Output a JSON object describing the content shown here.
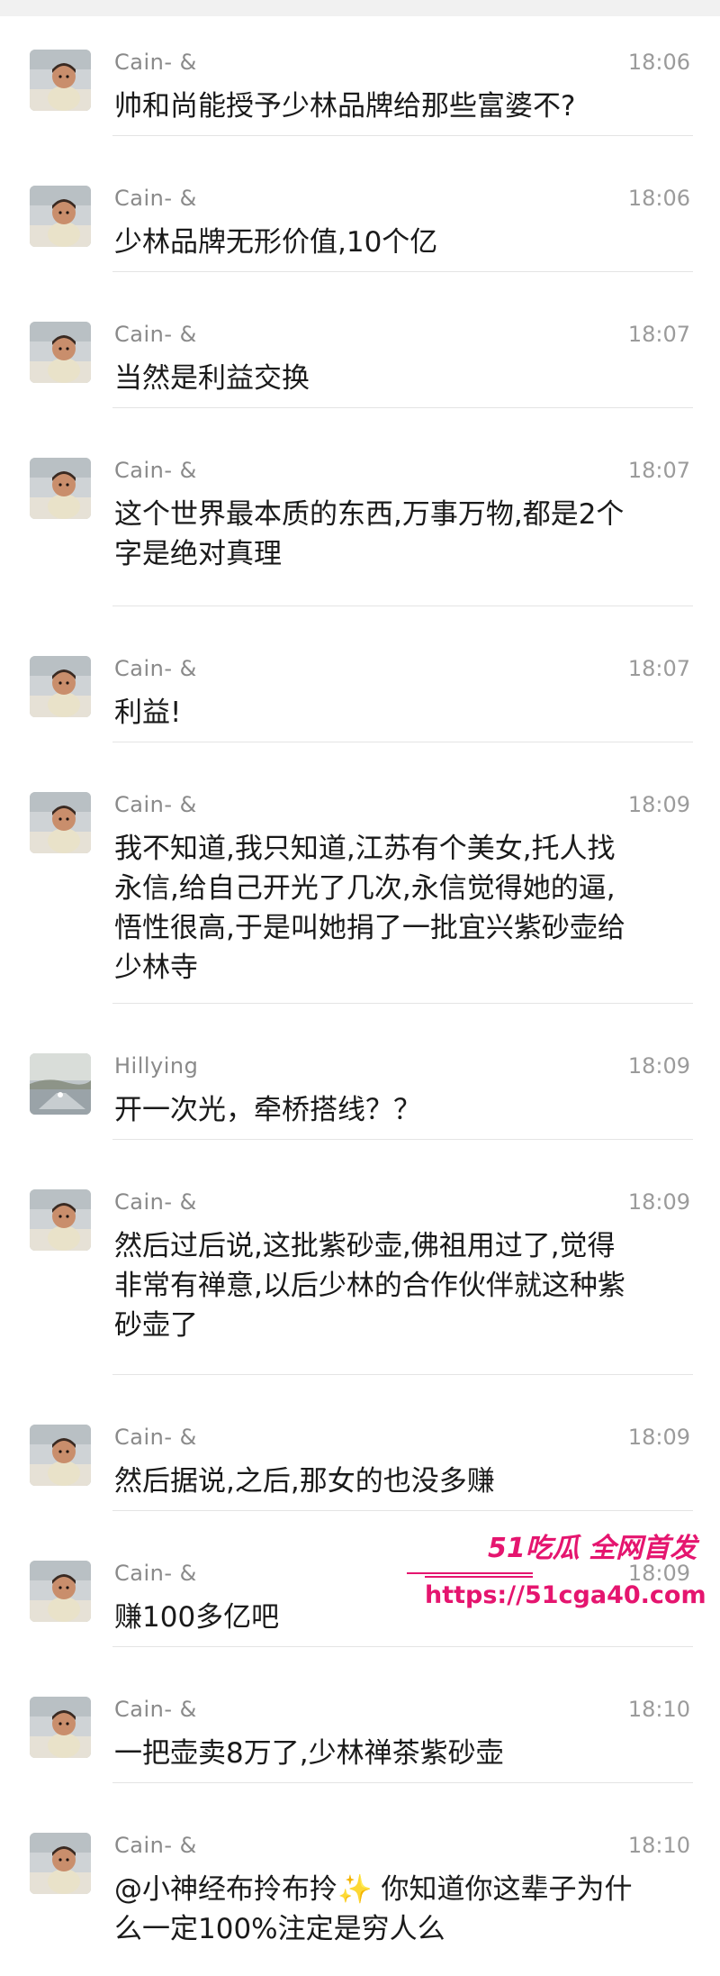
{
  "messages": [
    {
      "name": "Cain- &",
      "time": "18:06",
      "avatar": "child-avatar",
      "text_lines": [
        "帅和尚能授予少林品牌给那些富婆不?"
      ]
    },
    {
      "name": "Cain- &",
      "time": "18:06",
      "avatar": "child-avatar",
      "text_lines": [
        "少林品牌无形价值,10个亿"
      ]
    },
    {
      "name": "Cain- &",
      "time": "18:07",
      "avatar": "child-avatar",
      "text_lines": [
        "当然是利益交换"
      ]
    },
    {
      "name": "Cain- &",
      "time": "18:07",
      "avatar": "child-avatar",
      "text_lines": [
        "这个世界最本质的东西,万事万物,都是2个",
        "字是绝对真理"
      ]
    },
    {
      "name": "Cain- &",
      "time": "18:07",
      "avatar": "child-avatar",
      "text_lines": [
        "利益!"
      ]
    },
    {
      "name": "Cain- &",
      "time": "18:09",
      "avatar": "child-avatar",
      "text_lines": [
        "我不知道,我只知道,江苏有个美女,托人找",
        "永信,给自己开光了几次,永信觉得她的逼,",
        "悟性很高,于是叫她捐了一批宜兴紫砂壶给",
        "少林寺"
      ]
    },
    {
      "name": "Hillying",
      "time": "18:09",
      "avatar": "landscape-avatar",
      "text_lines": [
        "开一次光，牵桥搭线？？"
      ]
    },
    {
      "name": "Cain- &",
      "time": "18:09",
      "avatar": "child-avatar",
      "text_lines": [
        "然后过后说,这批紫砂壶,佛祖用过了,觉得",
        "非常有禅意,以后少林的合作伙伴就这种紫",
        "砂壶了"
      ]
    },
    {
      "name": "Cain- &",
      "time": "18:09",
      "avatar": "child-avatar",
      "text_lines": [
        "然后据说,之后,那女的也没多赚"
      ]
    },
    {
      "name": "Cain- &",
      "time": "18:09",
      "avatar": "child-avatar",
      "text_lines": [
        "赚100多亿吧"
      ]
    },
    {
      "name": "Cain- &",
      "time": "18:10",
      "avatar": "child-avatar",
      "text_lines": [
        "一把壶卖8万了,少林禅茶紫砂壶"
      ]
    },
    {
      "name": "Cain- &",
      "time": "18:10",
      "avatar": "child-avatar",
      "text_lines": [
        "@小神经布拎布拎✨ 你知道你这辈子为什",
        "么一定100%注定是穷人么"
      ]
    }
  ],
  "watermark": {
    "title": "51吃瓜 全网首发",
    "url": "https://51cga40.com"
  },
  "colors": {
    "name": "#8a8a8a",
    "time": "#9b9b9b",
    "text": "#1a1a1a",
    "separator": "#e4e4e4",
    "watermark": "#e5156f"
  }
}
